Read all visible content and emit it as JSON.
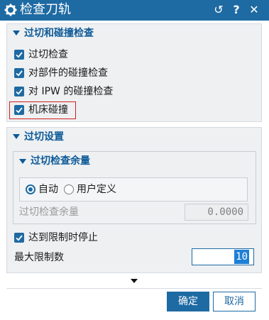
{
  "window": {
    "title": "检查刀轨",
    "buttons": {
      "reset": "↺",
      "help": "?",
      "close": "✕"
    }
  },
  "section_gouge": {
    "title": "过切和碰撞检查",
    "options": [
      {
        "label": "过切检查",
        "checked": true
      },
      {
        "label": "对部件的碰撞检查",
        "checked": true
      },
      {
        "label": "对 IPW 的碰撞检查",
        "checked": true
      },
      {
        "label": "机床碰撞",
        "checked": true
      }
    ]
  },
  "section_settings": {
    "title": "过切设置",
    "subsection": {
      "title": "过切检查余量",
      "radio": {
        "auto": "自动",
        "custom": "用户定义",
        "selected": "auto"
      },
      "tolerance_label": "过切检查余量",
      "tolerance_value": "0.0000"
    },
    "stop_at_limit": {
      "label": "达到限制时停止",
      "checked": true
    },
    "max_limit": {
      "label": "最大限制数",
      "value": "10"
    }
  },
  "footer": {
    "ok": "确定",
    "cancel": "取消"
  },
  "colors": {
    "accent": "#1e6aa3",
    "highlight": "#d02020"
  }
}
